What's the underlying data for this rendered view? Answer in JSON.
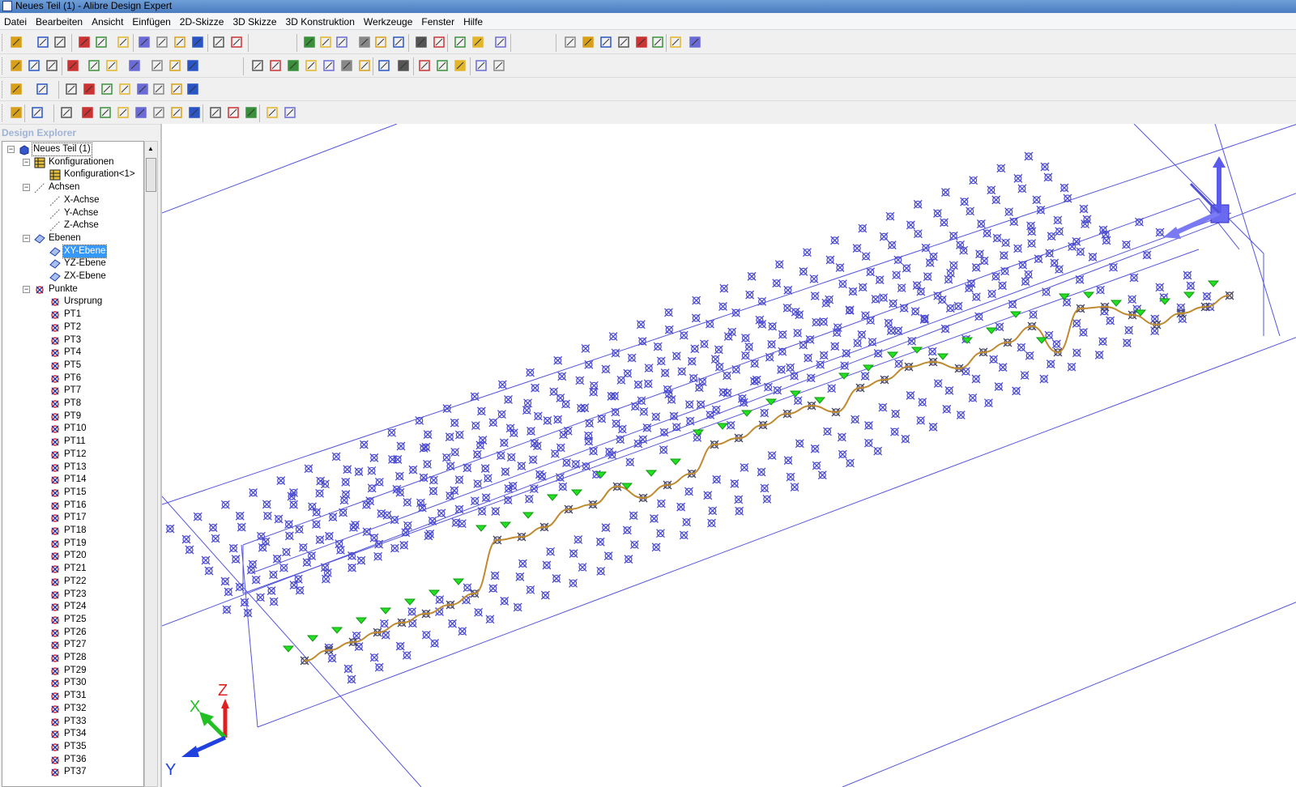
{
  "window": {
    "title": "Neues Teil (1) - Alibre Design Expert"
  },
  "menu": [
    "Datei",
    "Bearbeiten",
    "Ansicht",
    "Einfügen",
    "2D-Skizze",
    "3D Skizze",
    "3D Konstruktion",
    "Werkzeuge",
    "Fenster",
    "Hilfe"
  ],
  "explorer": {
    "title": "Design Explorer",
    "root": "Neues Teil (1)",
    "configurations": {
      "label": "Konfigurationen",
      "items": [
        "Konfiguration<1>"
      ]
    },
    "axes": {
      "label": "Achsen",
      "items": [
        "X-Achse",
        "Y-Achse",
        "Z-Achse"
      ]
    },
    "planes": {
      "label": "Ebenen",
      "items": [
        "XY-Ebene",
        "YZ-Ebene",
        "ZX-Ebene"
      ],
      "selected": "XY-Ebene"
    },
    "points": {
      "label": "Punkte",
      "items": [
        "Ursprung",
        "PT1",
        "PT2",
        "PT3",
        "PT4",
        "PT5",
        "PT6",
        "PT7",
        "PT8",
        "PT9",
        "PT10",
        "PT11",
        "PT12",
        "PT13",
        "PT14",
        "PT15",
        "PT16",
        "PT17",
        "PT18",
        "PT19",
        "PT20",
        "PT21",
        "PT22",
        "PT23",
        "PT24",
        "PT25",
        "PT26",
        "PT27",
        "PT28",
        "PT29",
        "PT30",
        "PT31",
        "PT32",
        "PT33",
        "PT34",
        "PT35",
        "PT36",
        "PT37"
      ]
    }
  },
  "triad": {
    "x": "X",
    "y": "Y",
    "z": "Z"
  },
  "colors": {
    "accent": "#4a7cc0",
    "point": "#4b4bd0",
    "spline": "#c08a2e",
    "green_marker": "#22e022",
    "selection": "#3399ff"
  }
}
